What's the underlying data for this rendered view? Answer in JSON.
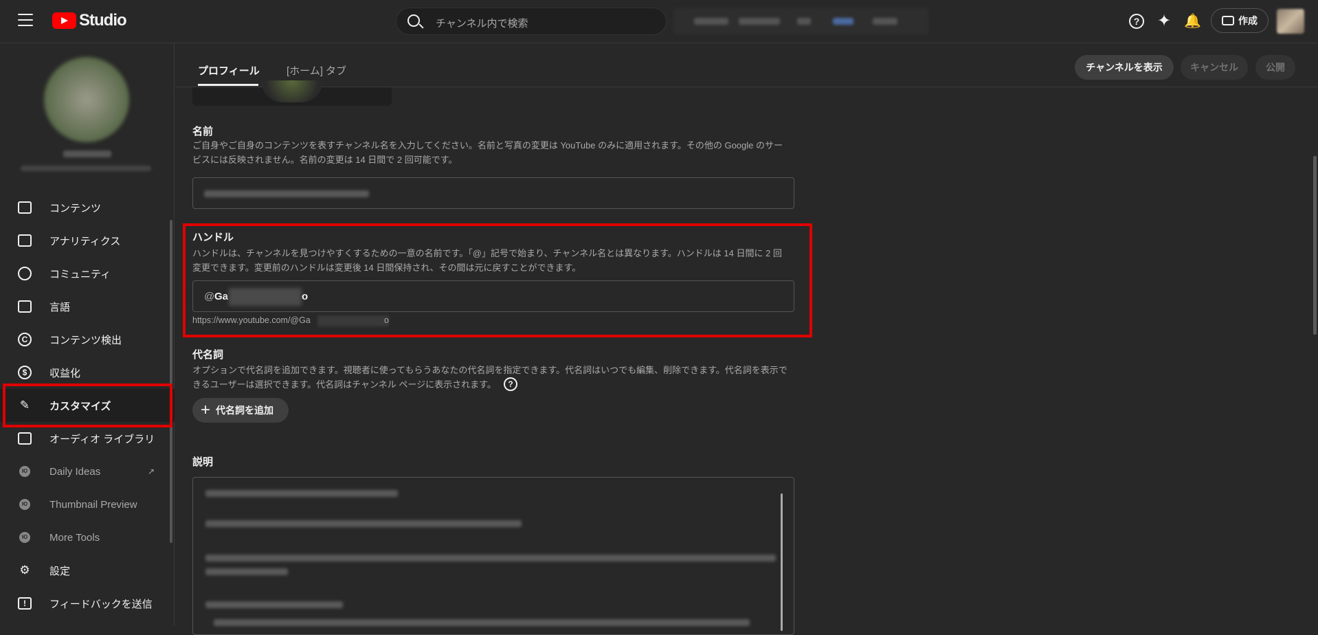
{
  "topbar": {
    "logo_text": "Studio",
    "search_placeholder": "チャンネル内で検索",
    "create_label": "作成",
    "help_glyph": "?",
    "spark_glyph": "✦",
    "bell_glyph": "🔔"
  },
  "sidebar": {
    "items": [
      {
        "label": "コンテンツ",
        "icon": "content-icon"
      },
      {
        "label": "アナリティクス",
        "icon": "analytics-icon"
      },
      {
        "label": "コミュニティ",
        "icon": "community-icon"
      },
      {
        "label": "言語",
        "icon": "subtitles-icon"
      },
      {
        "label": "コンテンツ検出",
        "icon": "copyright-icon"
      },
      {
        "label": "収益化",
        "icon": "monetization-icon"
      },
      {
        "label": "カスタマイズ",
        "icon": "customize-icon",
        "active": true
      },
      {
        "label": "オーディオ ライブラリ",
        "icon": "audio-library-icon"
      },
      {
        "label": "Daily Ideas",
        "icon": "app-icon",
        "external": true
      },
      {
        "label": "Thumbnail Preview",
        "icon": "app-icon"
      },
      {
        "label": "More Tools",
        "icon": "app-icon"
      },
      {
        "label": "設定",
        "icon": "settings-icon"
      },
      {
        "label": "フィードバックを送信",
        "icon": "feedback-icon"
      }
    ],
    "copyright_glyph": "C",
    "money_glyph": "$",
    "feedback_glyph": "!",
    "app_glyph": "Ю",
    "external_glyph": "↗"
  },
  "main": {
    "tabs": [
      {
        "label": "プロフィール",
        "active": true
      },
      {
        "label": "[ホーム] タブ",
        "active": false
      }
    ],
    "buttons": {
      "view_channel": "チャンネルを表示",
      "cancel": "キャンセル",
      "publish": "公開"
    },
    "name_section": {
      "title": "名前",
      "desc": "ご自身やご自身のコンテンツを表すチャンネル名を入力してください。名前と写真の変更は YouTube のみに適用されます。その他の Google のサービスには反映されません。名前の変更は 14 日間で 2 回可能です。"
    },
    "handle_section": {
      "title": "ハンドル",
      "desc": "ハンドルは、チャンネルを見つけやすくするための一意の名前です。「@」記号で始まり、チャンネル名とは異なります。ハンドルは 14 日間に 2 回変更できます。変更前のハンドルは変更後 14 日間保持され、その間は元に戻すことができます。",
      "at": "@",
      "value_start": "Ga",
      "value_end": "o",
      "url_start": "https://www.youtube.com/@Ga",
      "url_end": "o"
    },
    "pronoun_section": {
      "title": "代名詞",
      "desc": "オプションで代名詞を追加できます。視聴者に使ってもらうあなたの代名詞を指定できます。代名詞はいつでも編集、削除できます。代名詞を表示できるユーザーは選択できます。代名詞はチャンネル ページに表示されます。",
      "help": "?",
      "add_label": "代名詞を追加",
      "plus": "+"
    },
    "description_section": {
      "title": "説明"
    }
  }
}
